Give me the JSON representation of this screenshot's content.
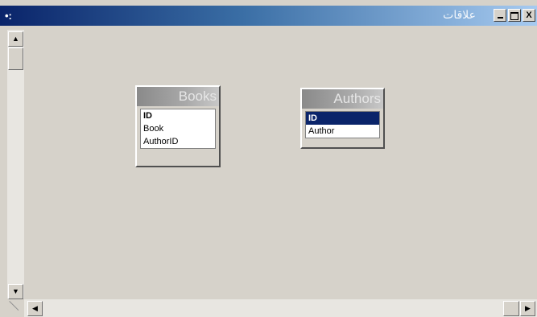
{
  "window": {
    "title": "علاقات",
    "system_menu_glyph": "•:",
    "close_glyph": "X",
    "minimize_glyph": "_"
  },
  "tables": [
    {
      "name": "Books",
      "fields": [
        {
          "label": "ID",
          "primary_key": true,
          "selected": false
        },
        {
          "label": "Book",
          "primary_key": false,
          "selected": false
        },
        {
          "label": "AuthorID",
          "primary_key": false,
          "selected": false
        }
      ]
    },
    {
      "name": "Authors",
      "fields": [
        {
          "label": "ID",
          "primary_key": true,
          "selected": true
        },
        {
          "label": "Author",
          "primary_key": false,
          "selected": false
        }
      ]
    }
  ],
  "scrollbars": {
    "up_arrow": "▲",
    "down_arrow": "▼",
    "left_arrow": "◀",
    "right_arrow": "▶"
  },
  "colors": {
    "title_gradient_start": "#0a246a",
    "title_gradient_end": "#a6caf0",
    "selection": "#0a246a",
    "window_bg": "#d6d2ca"
  }
}
